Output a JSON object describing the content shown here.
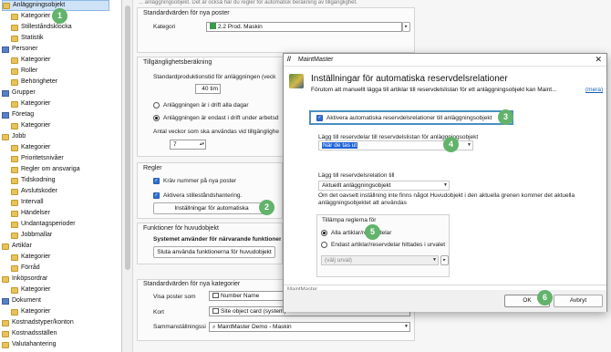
{
  "tree": {
    "items": [
      {
        "label": "Anläggningsobjekt",
        "icon": "folder-icon",
        "level": 0,
        "selected": true
      },
      {
        "label": "Kategorier",
        "icon": "folder-icon",
        "level": 1
      },
      {
        "label": "Stilleståndsklocka",
        "icon": "folder-icon",
        "level": 1
      },
      {
        "label": "Statistik",
        "icon": "folder-icon",
        "level": 1
      },
      {
        "label": "Personer",
        "icon": "person-icon",
        "level": 0
      },
      {
        "label": "Kategorier",
        "icon": "folder-icon",
        "level": 1
      },
      {
        "label": "Roller",
        "icon": "folder-icon",
        "level": 1
      },
      {
        "label": "Behörigheter",
        "icon": "folder-icon",
        "level": 1
      },
      {
        "label": "Grupper",
        "icon": "group-icon",
        "level": 0
      },
      {
        "label": "Kategorier",
        "icon": "folder-icon",
        "level": 1
      },
      {
        "label": "Företag",
        "icon": "company-icon",
        "level": 0
      },
      {
        "label": "Kategorier",
        "icon": "folder-icon",
        "level": 1
      },
      {
        "label": "Jobb",
        "icon": "job-icon",
        "level": 0
      },
      {
        "label": "Kategorier",
        "icon": "folder-icon",
        "level": 1
      },
      {
        "label": "Prioritetsnivåer",
        "icon": "folder-icon",
        "level": 1
      },
      {
        "label": "Regler om ansvariga",
        "icon": "folder-icon",
        "level": 1
      },
      {
        "label": "Tidskodning",
        "icon": "folder-icon",
        "level": 1
      },
      {
        "label": "Avslutskoder",
        "icon": "folder-icon",
        "level": 1
      },
      {
        "label": "Intervall",
        "icon": "folder-icon",
        "level": 1
      },
      {
        "label": "Händelser",
        "icon": "folder-icon",
        "level": 1
      },
      {
        "label": "Undantagsperioder",
        "icon": "folder-icon",
        "level": 1
      },
      {
        "label": "Jobbmallar",
        "icon": "folder-icon",
        "level": 1
      },
      {
        "label": "Artiklar",
        "icon": "article-icon",
        "level": 0
      },
      {
        "label": "Kategorier",
        "icon": "folder-icon",
        "level": 1
      },
      {
        "label": "Förråd",
        "icon": "folder-icon",
        "level": 1
      },
      {
        "label": "Inköpsordrar",
        "icon": "order-icon",
        "level": 0
      },
      {
        "label": "Kategorier",
        "icon": "folder-icon",
        "level": 1
      },
      {
        "label": "Dokument",
        "icon": "document-icon",
        "level": 0
      },
      {
        "label": "Kategorier",
        "icon": "folder-icon",
        "level": 1
      },
      {
        "label": "Kostnadstyper/konton",
        "icon": "folder-icon",
        "level": 0
      },
      {
        "label": "Kostnadsställen",
        "icon": "folder-icon",
        "level": 0
      },
      {
        "label": "Valutahantering",
        "icon": "folder-icon",
        "level": 0
      }
    ]
  },
  "main": {
    "top_info": "... anläggningsobjekt. Det är också här du regler för automatisk beräkning av tillgänglighet.",
    "standard_new": {
      "title": "Standardvärden för nya poster",
      "category_label": "Kategori",
      "category_value": "2.2 Prod. Maskin"
    },
    "availability": {
      "title": "Tillgänglighetsberäkning",
      "prod_label": "Standardproduktionstid för anläggningen (veck",
      "hours_value": "40 tim",
      "radio_all": "Anläggningen är i drift alla dagar",
      "radio_workdays": "Anläggningen är endast i drift under arbetsd",
      "weeks_label": "Antal veckor som ska användas vid tillgänglighe",
      "weeks_value": "7"
    },
    "rules": {
      "title": "Regler",
      "require_number": "Kräv nummer på nya poster",
      "activate_standstill": "Aktivera stilleståndshantering.",
      "settings_button": "Inställningar för automatiska"
    },
    "functions": {
      "title": "Funktioner för huvudobjekt",
      "systems_label": "Systemet använder för närvarande funktioner f",
      "stop_button": "Sluta använda funktionerna för huvudobjekt"
    },
    "categories_defaults": {
      "title": "Standardvärden för nya kategorier",
      "show_label": "Visa poster som",
      "show_value": "Number Name",
      "card_label": "Kort",
      "card_value": "Site object card (system)",
      "summary_label": "Sammanställningssi",
      "summary_value": "MaintMaster Demo - Maskin"
    }
  },
  "dialog": {
    "window_title": "MaintMaster",
    "heading": "Inställningar för automatiska reservdelsrelationer",
    "description": "Förutom att manuellt lägga till artiklar till reservdelslistan för ett anläggningsobjekt kan Maint...",
    "more_link": "(mera)",
    "activate_label": "Aktivera automatiska reservdelsrelationer till anläggningsobjekt",
    "when_label": "Lägg till reservdelar till reservdelslistan för anläggningsobjekt",
    "when_value": "När de tas ut",
    "relation_label": "Lägg till reservdelsrelation till",
    "relation_value": "Aktuellt anläggningsobjekt",
    "note": "Om det oavsett inställning inte finns något Huvudobjekt i den aktuella grenen kommer det aktuella anläggningsobjektet att användas",
    "apply_group_title": "Tillämpa reglerna för",
    "apply_all": "Alla artiklar/reservdelar",
    "apply_only": "Endast artiklar/reservdelar hittades i urvalet",
    "selection_placeholder": "(välj urval)",
    "footer_brand": "MaintMaster",
    "ok_button": "OK",
    "cancel_button": "Avbryt"
  },
  "badges": [
    "1",
    "2",
    "3",
    "4",
    "5",
    "6"
  ],
  "colors": {
    "badge": "#62b36b",
    "highlight": "#4a90c2",
    "accent": "#2f6fd6"
  }
}
